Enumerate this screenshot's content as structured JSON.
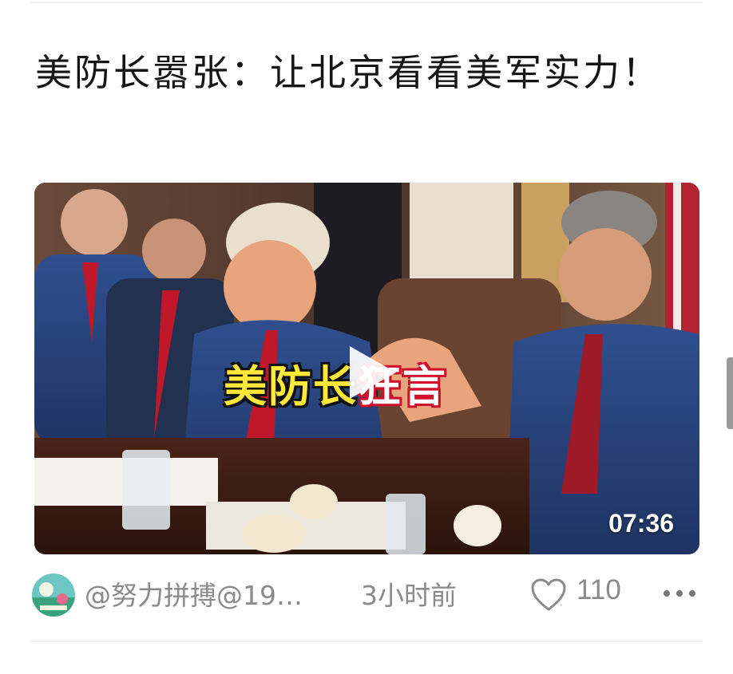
{
  "article": {
    "title": "美防长嚣张：让北京看看美军实力！"
  },
  "video": {
    "caption_part1": "美防长",
    "caption_part2": "狂言",
    "duration": "07:36"
  },
  "meta": {
    "author": "@努力拼搏@19…",
    "time_ago": "3小时前",
    "likes": "110"
  },
  "icons": {
    "play": "play-icon",
    "like": "heart-icon",
    "more": "more-dots-icon"
  },
  "colors": {
    "title_text": "#151515",
    "meta_text": "#8a8a8a",
    "caption_yellow": "#ffe83a",
    "caption_red": "#d0102a"
  }
}
